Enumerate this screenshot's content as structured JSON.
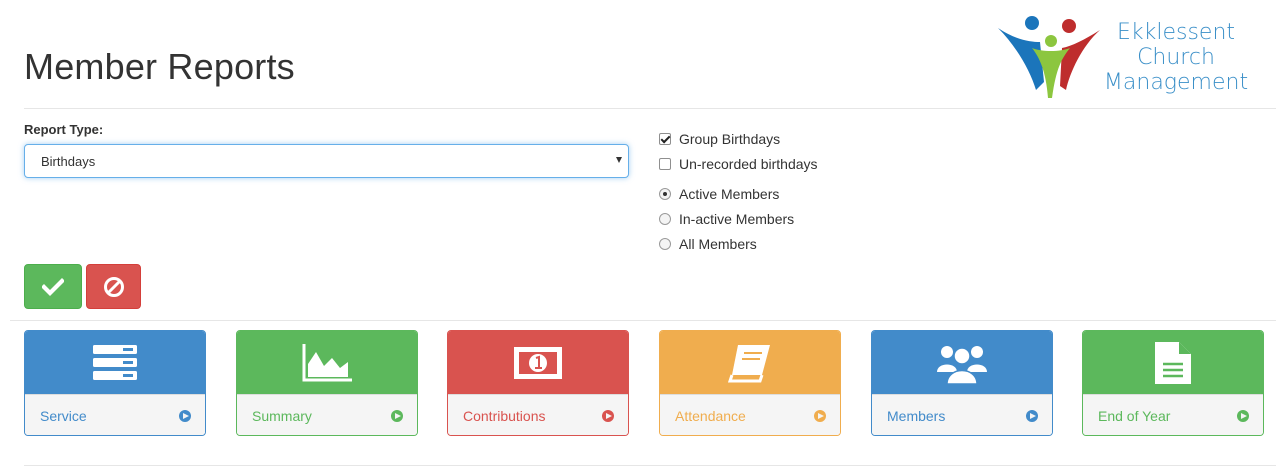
{
  "header": {
    "title": "Member Reports",
    "logo": {
      "line1": "Ekklessent",
      "line2": "Church",
      "line3": "Management",
      "icon": "people-logo-icon"
    }
  },
  "form": {
    "report_type_label": "Report Type:",
    "report_type_value": "Birthdays",
    "checkboxes": [
      {
        "label": "Group Birthdays",
        "checked": true
      },
      {
        "label": "Un-recorded birthdays",
        "checked": false
      }
    ],
    "radios": [
      {
        "label": "Active Members",
        "checked": true
      },
      {
        "label": "In-active Members",
        "checked": false
      },
      {
        "label": "All Members",
        "checked": false
      }
    ],
    "submit_icon": "check-icon",
    "cancel_icon": "ban-icon"
  },
  "tiles": [
    {
      "label": "Service",
      "icon": "server-icon",
      "color": "#428bca"
    },
    {
      "label": "Summary",
      "icon": "area-chart-icon",
      "color": "#5cb85c"
    },
    {
      "label": "Contributions",
      "icon": "money-icon",
      "color": "#d9534f"
    },
    {
      "label": "Attendance",
      "icon": "book-icon",
      "color": "#f0ad4e"
    },
    {
      "label": "Members",
      "icon": "users-icon",
      "color": "#428bca"
    },
    {
      "label": "End of Year",
      "icon": "file-text-icon",
      "color": "#5cb85c"
    }
  ]
}
